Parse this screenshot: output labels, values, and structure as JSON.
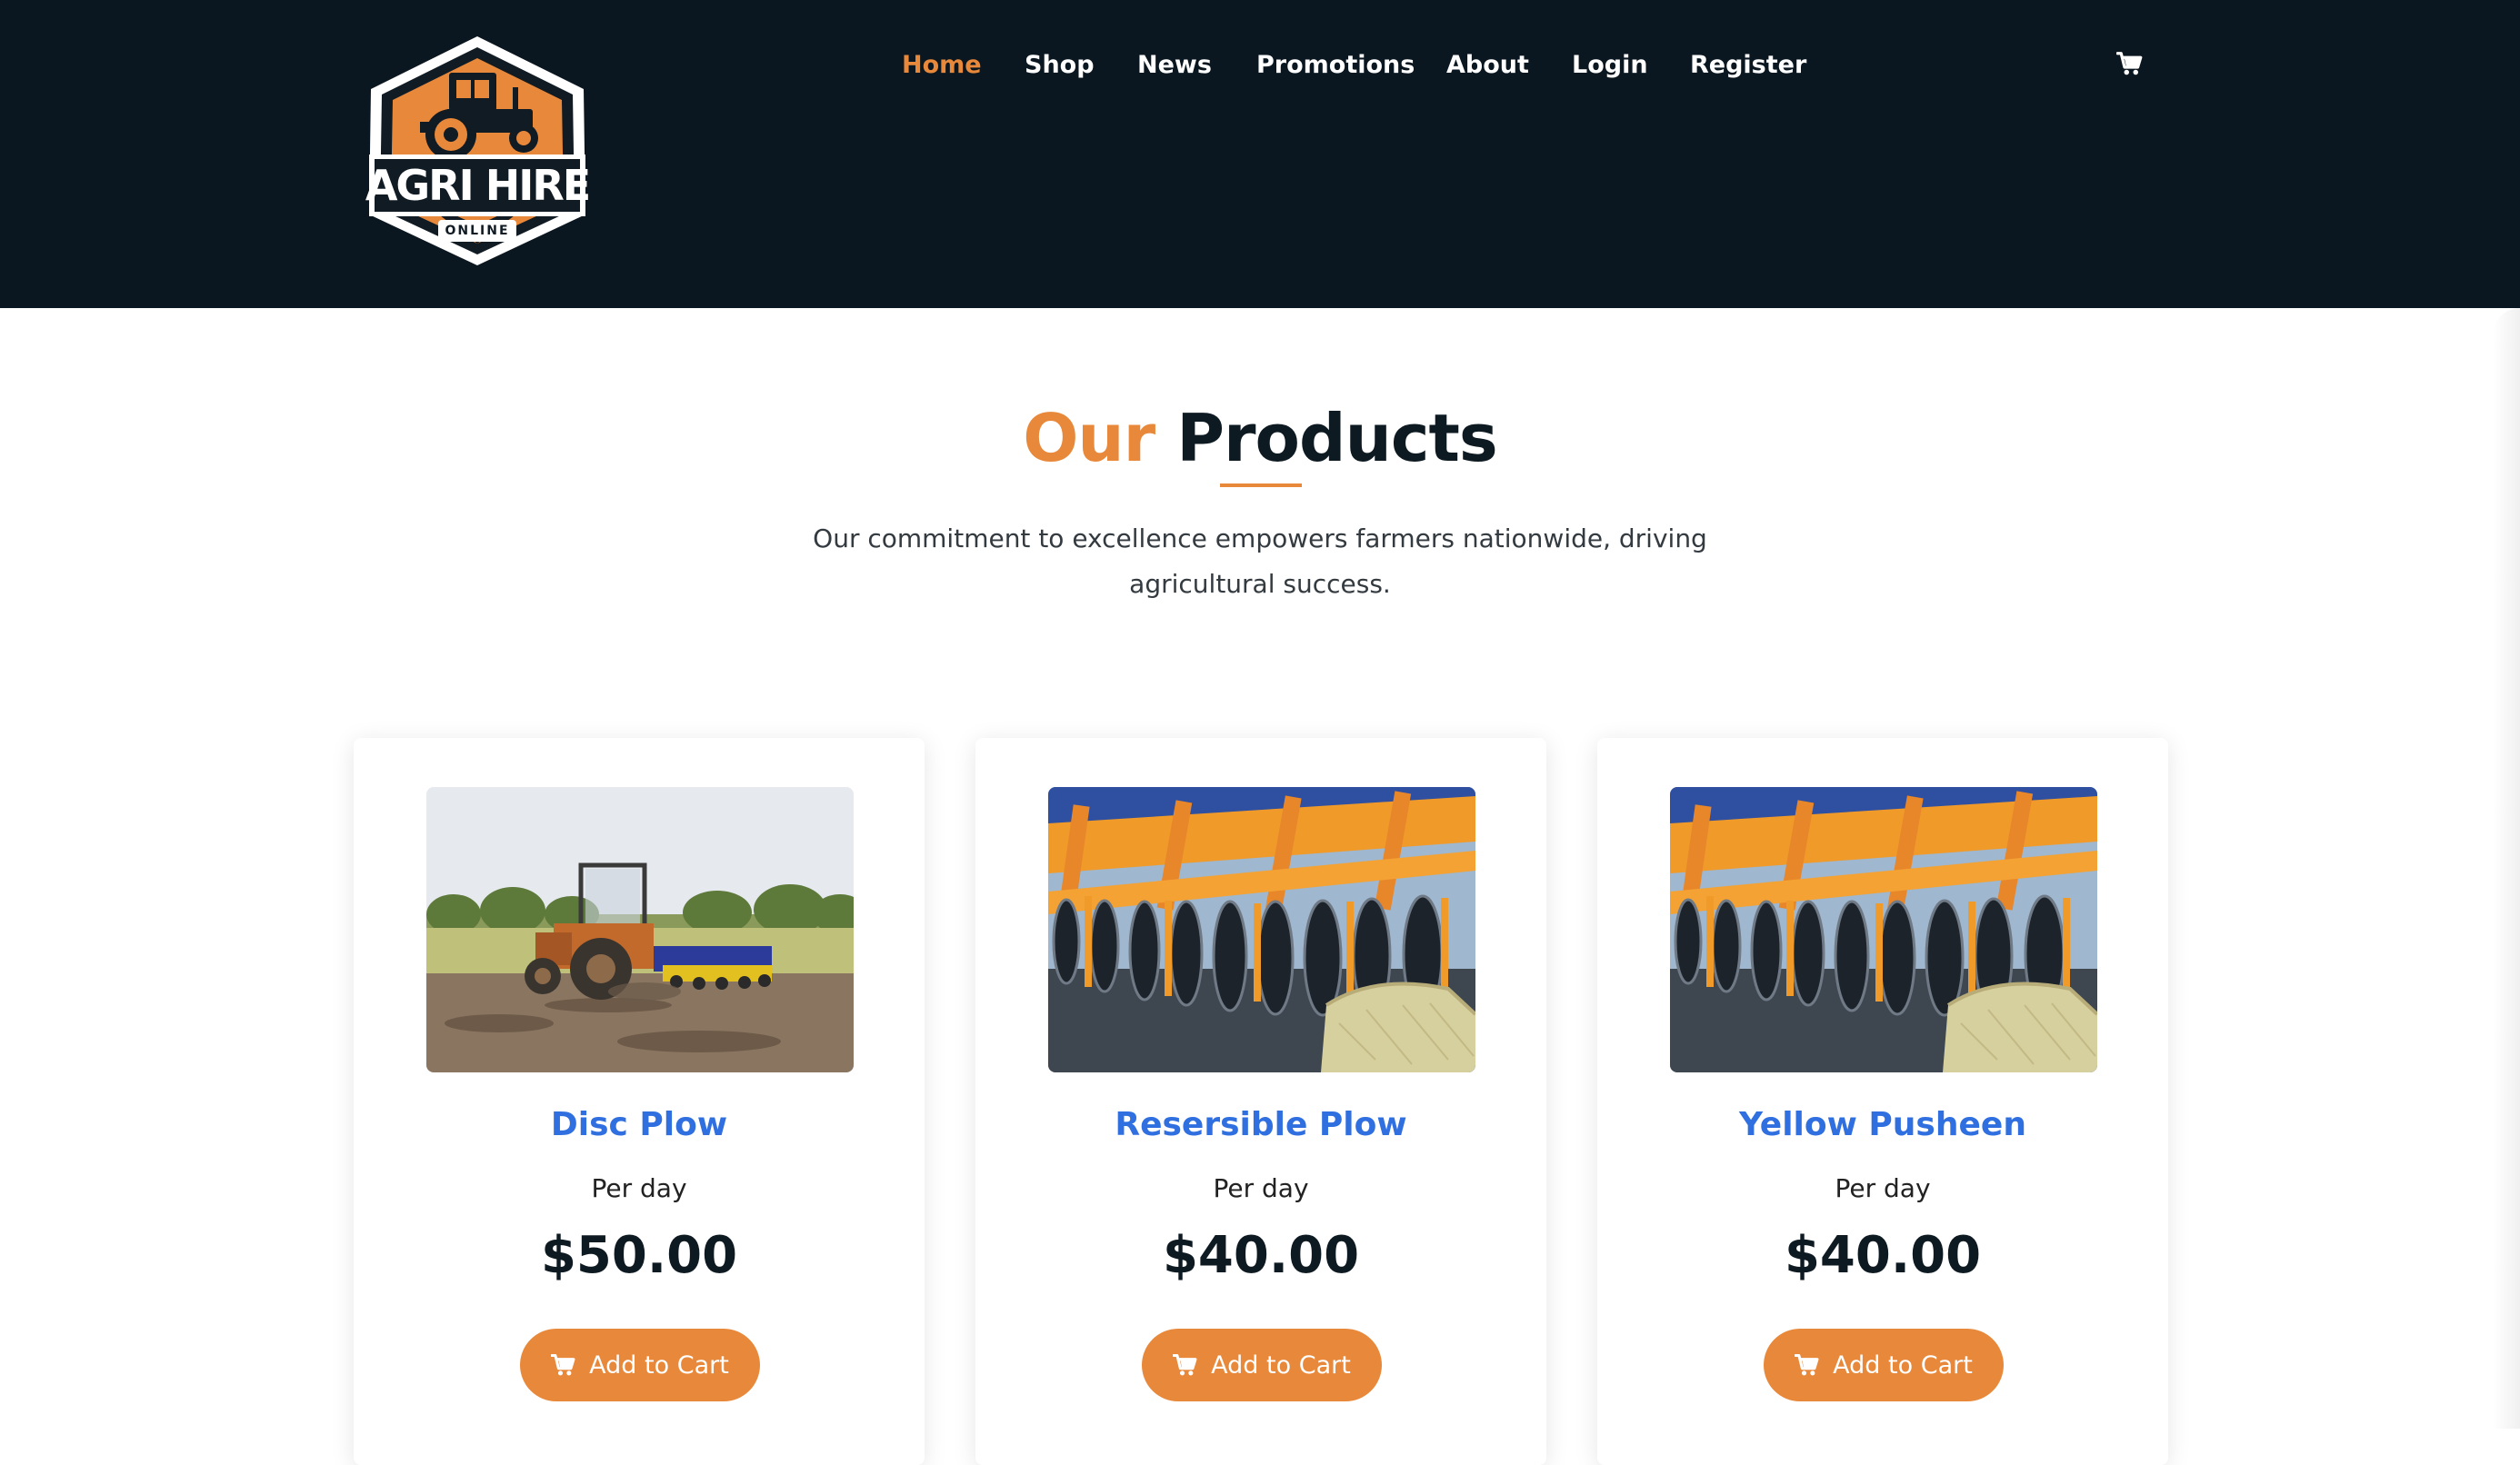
{
  "brand": {
    "logo_text": "AGRI HIRE",
    "logo_subtext": "ONLINE",
    "colors": {
      "accent": "#e8883a",
      "header_bg": "#0b1720",
      "title_link": "#2f6fe0",
      "dark_text": "#0e1a22"
    }
  },
  "nav": {
    "items": [
      {
        "label": "Home",
        "active": true
      },
      {
        "label": "Shop",
        "active": false
      },
      {
        "label": "News",
        "active": false
      },
      {
        "label": "Promotions",
        "active": false
      },
      {
        "label": "About",
        "active": false
      },
      {
        "label": "Login",
        "active": false
      },
      {
        "label": "Register",
        "active": false
      }
    ],
    "cart_icon": "shopping-cart-icon"
  },
  "section": {
    "title_accent": "Our",
    "title_main": "Products",
    "subtitle": "Our commitment to excellence empowers farmers nationwide, driving agricultural success."
  },
  "products": [
    {
      "name": "Disc Plow",
      "unit": "Per day",
      "price": "$50.00",
      "button_label": "Add to Cart",
      "image": "tractor-with-plow-photo"
    },
    {
      "name": "Resersible Plow",
      "unit": "Per day",
      "price": "$40.00",
      "button_label": "Add to Cart",
      "image": "disc-harrow-with-hay-photo"
    },
    {
      "name": "Yellow Pusheen",
      "unit": "Per day",
      "price": "$40.00",
      "button_label": "Add to Cart",
      "image": "disc-harrow-with-hay-photo"
    }
  ]
}
